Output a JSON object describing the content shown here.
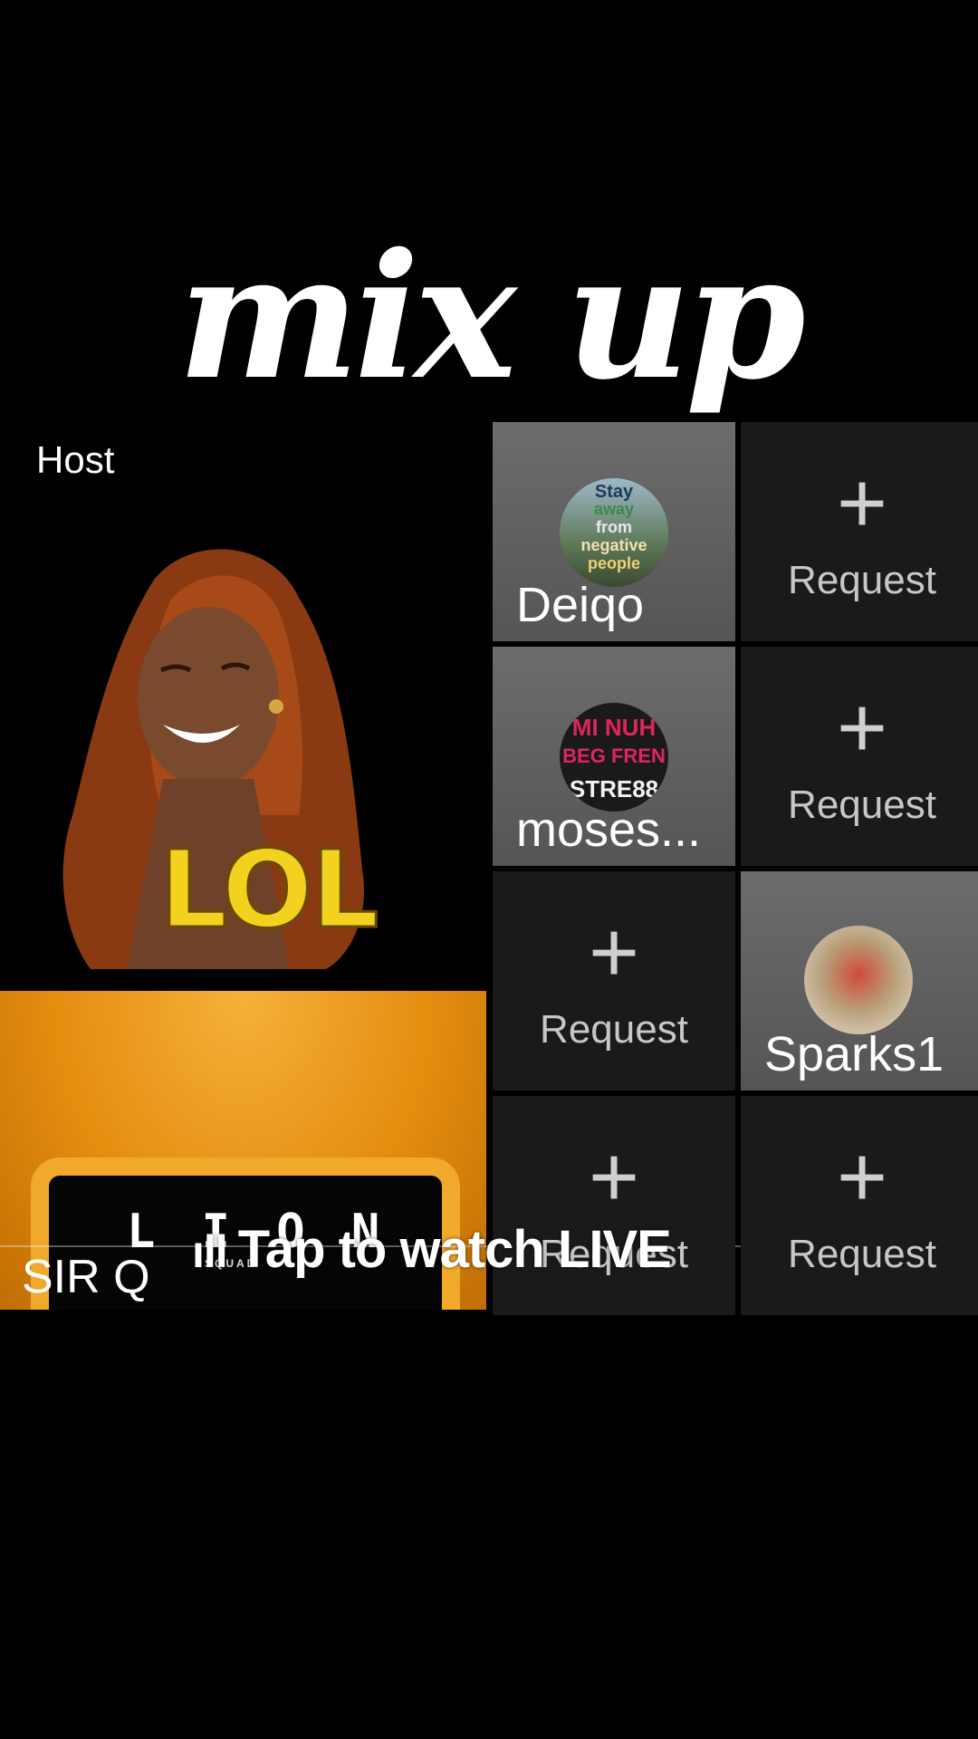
{
  "title": "mix up",
  "host": {
    "label": "Host",
    "sticker_text": "LOL"
  },
  "guest_big": {
    "name": "SIR Q",
    "logo_word": "L I O N",
    "logo_sub": "SQUAD"
  },
  "seats": {
    "deigo": {
      "name": "Deiqo",
      "avatar_lines": [
        "Stay",
        "away",
        "from",
        "negative",
        "people"
      ]
    },
    "moses": {
      "name": "moses...",
      "avatar_lines": [
        "MI NUH",
        "BEG FREN",
        "STRE88"
      ]
    },
    "sparks": {
      "name": "Sparks1"
    },
    "request_label": "Request",
    "plus_symbol": "+"
  },
  "banner": {
    "icon": "ıll",
    "text": "Tap to watch LIVE"
  },
  "colors": {
    "lol_yellow": "#f2d21f",
    "guest_orange": "#e48d0f",
    "empty_seat": "#1a1a1a",
    "occupied_seat": "#5f5f5f"
  }
}
